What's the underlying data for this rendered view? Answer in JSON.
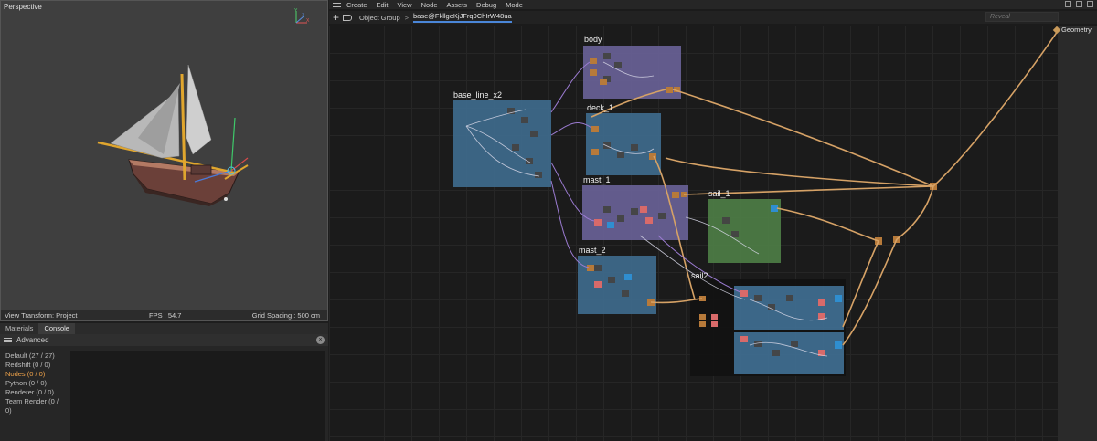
{
  "viewport": {
    "title": "Perspective",
    "view_transform": "View Transform: Project",
    "fps": "FPS : 54.7",
    "grid_spacing": "Grid Spacing : 500 cm"
  },
  "console_panel": {
    "tabs": [
      "Materials",
      "Console"
    ],
    "toolbar_label": "Advanced",
    "close_icon": "close-icon",
    "items": [
      {
        "label": "Default (27 / 27)",
        "active": false
      },
      {
        "label": "Redshift (0 / 0)",
        "active": false
      },
      {
        "label": "Nodes (0 / 0)",
        "active": true
      },
      {
        "label": "Python (0 / 0)",
        "active": false
      },
      {
        "label": "Renderer (0 / 0)",
        "active": false
      },
      {
        "label": "Team Render  (0 / 0)",
        "active": false
      }
    ]
  },
  "node_editor": {
    "menu": [
      "Create",
      "Edit",
      "View",
      "Node",
      "Assets",
      "Debug",
      "Mode"
    ],
    "breadcrumbs": [
      "Object Group",
      "base@FkllgeKjJFrq9ChIrW48ua"
    ],
    "reveal_placeholder": "Reveal",
    "output_label": "Geometry",
    "groups": [
      {
        "label": "body",
        "color": "#7a6fa8"
      },
      {
        "label": "base_line_x2",
        "color": "#4a7a9a"
      },
      {
        "label": "deck_1",
        "color": "#4a7a9a"
      },
      {
        "label": "mast_1",
        "color": "#7a6fa8"
      },
      {
        "label": "sail_1",
        "color": "#5a8a4f"
      },
      {
        "label": "mast_2",
        "color": "#4a7a9a"
      },
      {
        "label": "sail2",
        "color": "#4a7a9a"
      }
    ]
  },
  "colors": {
    "wire_orange": "#d6a266",
    "port_orange": "#b77a3a",
    "port_red": "#d86a6a",
    "port_blue": "#2f8ed0",
    "wire_purple": "#9b7bd1",
    "wire_white": "#d8d8e8"
  }
}
